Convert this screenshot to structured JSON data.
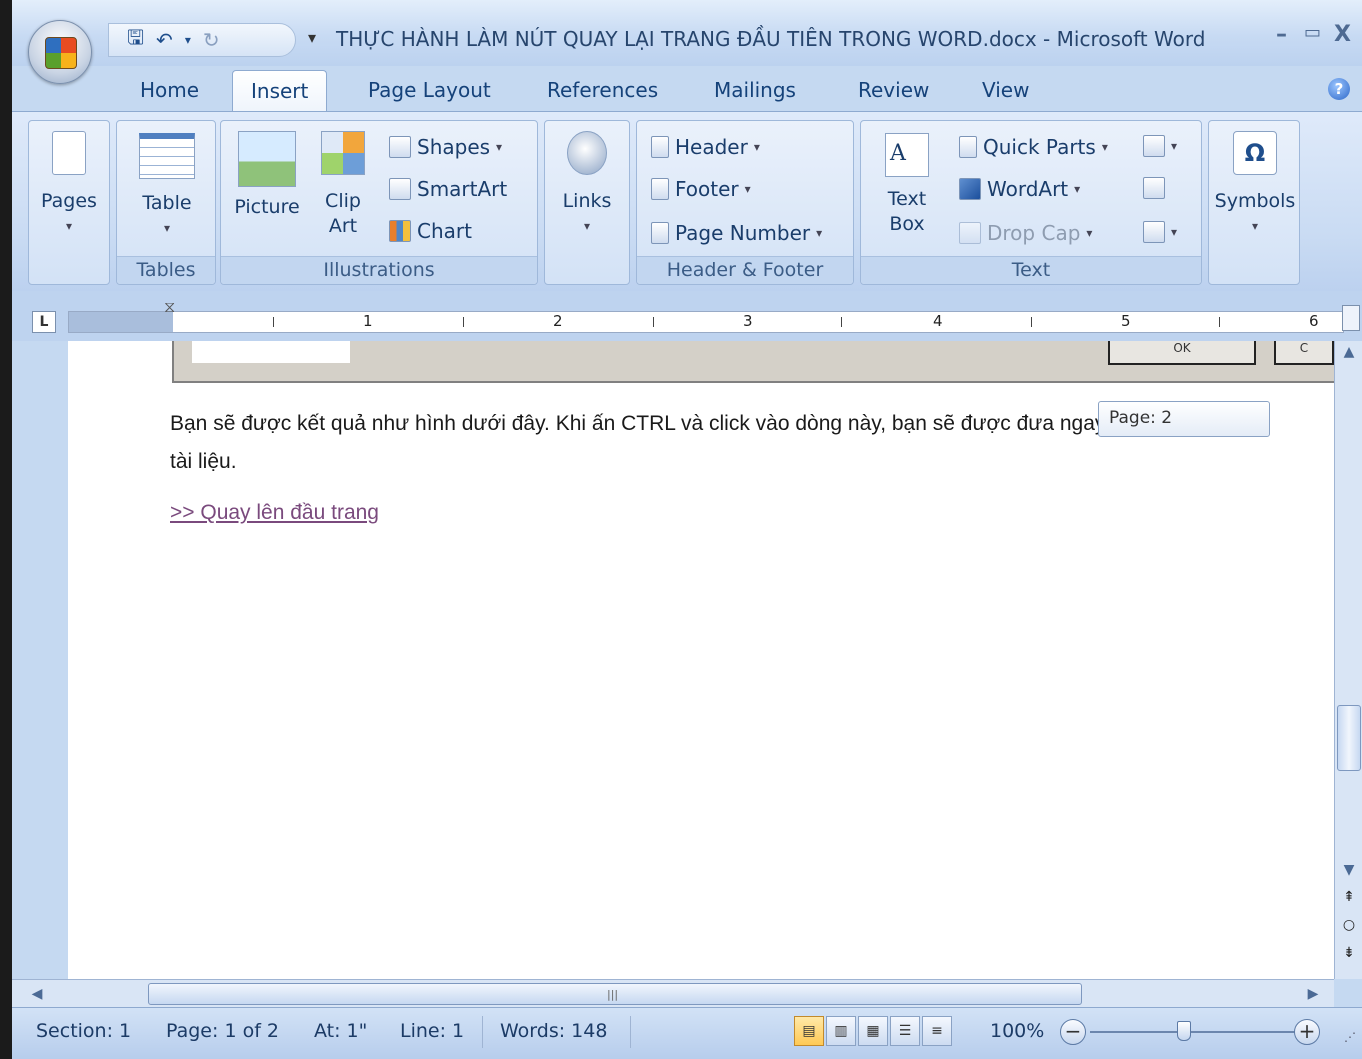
{
  "window": {
    "title": "THỰC HÀNH LÀM NÚT QUAY LẠI TRANG ĐẦU TIÊN TRONG WORD.docx - Microsoft Word",
    "minimize": "–",
    "maximize": "▭",
    "close": "X"
  },
  "tabs": [
    {
      "label": "Home"
    },
    {
      "label": "Insert"
    },
    {
      "label": "Page Layout"
    },
    {
      "label": "References"
    },
    {
      "label": "Mailings"
    },
    {
      "label": "Review"
    },
    {
      "label": "View"
    }
  ],
  "ribbon": {
    "pages": {
      "label": "Pages"
    },
    "tables": {
      "table": "Table",
      "group": "Tables"
    },
    "illustrations": {
      "picture": "Picture",
      "clip_art_1": "Clip",
      "clip_art_2": "Art",
      "shapes": "Shapes",
      "smartart": "SmartArt",
      "chart": "Chart",
      "group": "Illustrations"
    },
    "links": {
      "label": "Links"
    },
    "header_footer": {
      "header": "Header",
      "footer": "Footer",
      "page_number": "Page Number",
      "group": "Header & Footer"
    },
    "text": {
      "text_box_1": "Text",
      "text_box_2": "Box",
      "quick_parts": "Quick Parts",
      "wordart": "WordArt",
      "drop_cap": "Drop Cap",
      "group": "Text"
    },
    "symbols": {
      "label": "Symbols",
      "glyph": "Ω"
    }
  },
  "ruler": {
    "tab_selector": "L",
    "numbers": [
      "1",
      "2",
      "3",
      "4",
      "5",
      "6"
    ]
  },
  "document": {
    "line1": "Bạn sẽ được kết quả như hình dưới đây. Khi ấn CTRL và click vào dòng này, bạn sẽ được đưa ngay về",
    "line2": "tài liệu.",
    "link": ">> Quay lên đầu trang",
    "tooltip": "Page: 2",
    "dialog_ok": "OK",
    "dialog_cancel": "C"
  },
  "statusbar": {
    "section": "Section: 1",
    "page": "Page: 1 of 2",
    "at": "At: 1\"",
    "line": "Line: 1",
    "words": "Words: 148",
    "zoom": "100%"
  },
  "zoom": {
    "level": 1.0
  }
}
